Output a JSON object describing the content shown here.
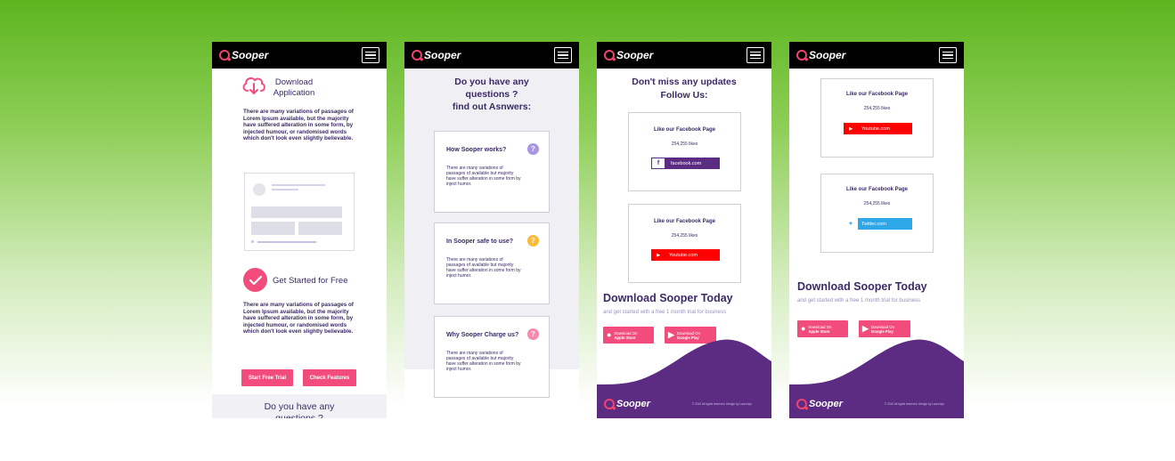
{
  "brand": "Sooper",
  "colors": {
    "pink": "#f24c7c",
    "purple": "#5b2c82",
    "dark_text": "#3b2a66",
    "facebook": "#5b2c82",
    "youtube": "#ff0000",
    "twitter": "#2ea7e8"
  },
  "screen1": {
    "download_title": "Download Application",
    "para1": "There are many variations of passages of Lorem Ipsum available, but the majority have suffered alteration in some form, by injected humour, or randomised words which don't look even slightly believable.",
    "get_started": "Get Started for Free",
    "para2": "There are many variations of passages of Lorem Ipsum available, but the majority have suffered alteration in some form, by injected humour, or randomised words which don't look even slightly believable.",
    "btn_trial": "Start Free Trial",
    "btn_features": "Check Features",
    "bottom_heading": "Do you have any questions ?"
  },
  "screen2": {
    "heading_l1": "Do you have any",
    "heading_l2": "questions ?",
    "heading_l3": "find out Asnwers:",
    "faqs": [
      {
        "q": "How Sooper works?",
        "a": "There are many variations of passages of available but majority have suffer alteration in some form by inject humor."
      },
      {
        "q": "In Sooper safe to use?",
        "a": "There are many variations of passages of available but majority have suffer alteration in some form by inject humor."
      },
      {
        "q": "Why Sooper Charge us?",
        "a": "There are many variations of passages of available but majority have suffer alteration in some form by inject humor."
      }
    ]
  },
  "screen3": {
    "heading_l1": "Don't miss any updates",
    "heading_l2": "Follow Us:",
    "cards": [
      {
        "title": "Like our Facebook Page",
        "likes": "254,255 likes",
        "link": "facebook.com",
        "icon": "f"
      },
      {
        "title": "Like our Facebook Page",
        "likes": "254,255 likes",
        "link": "Youtube.com",
        "icon": "▶"
      }
    ],
    "download_title": "Download Sooper Today",
    "download_sub": "and get started with a free 1 month trial for business",
    "apple_label_l1": "Download On",
    "apple_label_l2": "Apple Store",
    "google_label_l1": "Download On",
    "google_label_l2": "Google Play",
    "copyright": "© 2019 All rights reserved. Design by Laurvinyo"
  },
  "screen4": {
    "cards": [
      {
        "title": "Like our Facebook Page",
        "likes": "254,255 likes",
        "link": "Youtube.com",
        "icon": "▶"
      },
      {
        "title": "Like our Facebook Page",
        "likes": "254,255 likes",
        "link": "Twitter.com",
        "icon": "🐦"
      }
    ],
    "download_title": "Download Sooper Today",
    "download_sub": "and get started with a free 1 month trial for business",
    "apple_label_l1": "Download On",
    "apple_label_l2": "Apple Store",
    "google_label_l1": "Download On",
    "google_label_l2": "Google Play",
    "copyright": "© 2019 All rights reserved. Design by Laurvinyo"
  }
}
